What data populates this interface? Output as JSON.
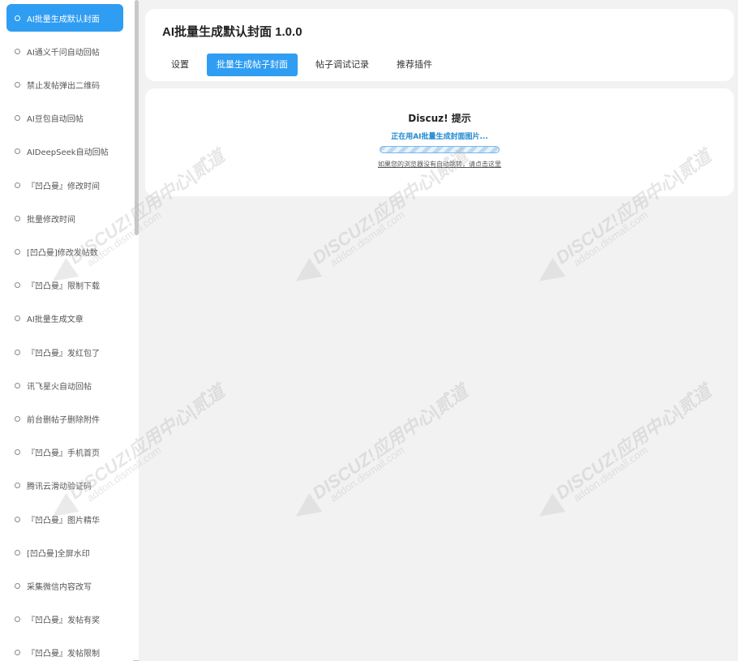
{
  "sidebar": {
    "items": [
      {
        "label": "AI批量生成默认封面",
        "active": true
      },
      {
        "label": "AI通义千问自动回帖",
        "active": false
      },
      {
        "label": "禁止发帖弹出二维码",
        "active": false
      },
      {
        "label": "AI豆包自动回帖",
        "active": false
      },
      {
        "label": "AIDeepSeek自动回帖",
        "active": false
      },
      {
        "label": "『凹凸曼』修改时间",
        "active": false
      },
      {
        "label": "批量修改时间",
        "active": false
      },
      {
        "label": "[凹凸曼]修改发帖数",
        "active": false
      },
      {
        "label": "『凹凸曼』限制下载",
        "active": false
      },
      {
        "label": "AI批量生成文章",
        "active": false
      },
      {
        "label": "『凹凸曼』发红包了",
        "active": false
      },
      {
        "label": "讯飞星火自动回帖",
        "active": false
      },
      {
        "label": "前台删帖子删除附件",
        "active": false
      },
      {
        "label": "『凹凸曼』手机首页",
        "active": false
      },
      {
        "label": "腾讯云滑动验证码",
        "active": false
      },
      {
        "label": "『凹凸曼』图片精华",
        "active": false
      },
      {
        "label": "[凹凸曼]全屏水印",
        "active": false
      },
      {
        "label": "采集微信内容改写",
        "active": false
      },
      {
        "label": "『凹凸曼』发帖有奖",
        "active": false
      },
      {
        "label": "『凹凸曼』发帖限制",
        "active": false
      }
    ]
  },
  "header": {
    "title": "AI批量生成默认封面 1.0.0",
    "tabs": [
      {
        "label": "设置",
        "active": false
      },
      {
        "label": "批量生成帖子封面",
        "active": true
      },
      {
        "label": "帖子调试记录",
        "active": false
      },
      {
        "label": "推荐插件",
        "active": false
      }
    ]
  },
  "message": {
    "title": "Discuz! 提示",
    "status": "正在用AI批量生成封面图片...",
    "redirect_link": "如果您的浏览器没有自动跳转，请点击这里"
  },
  "watermark": {
    "brand": "DISCUZ!应用中心|贰道",
    "url": "addon.dismall.com"
  },
  "colors": {
    "accent": "#2f9df2",
    "status_text": "#1e88d0",
    "page_bg": "#f2f2f3"
  }
}
